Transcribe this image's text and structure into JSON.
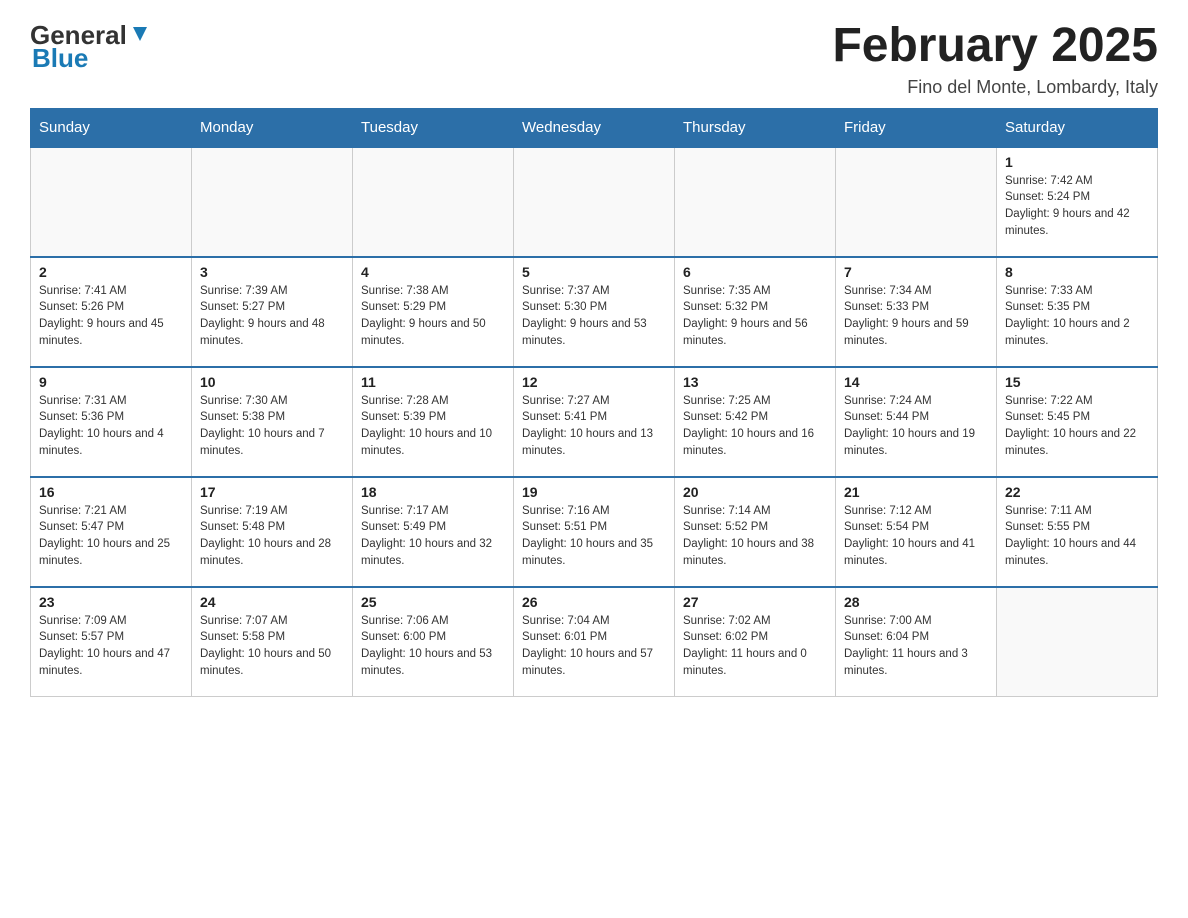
{
  "header": {
    "logo_general": "General",
    "logo_blue": "Blue",
    "month_title": "February 2025",
    "subtitle": "Fino del Monte, Lombardy, Italy"
  },
  "weekdays": [
    "Sunday",
    "Monday",
    "Tuesday",
    "Wednesday",
    "Thursday",
    "Friday",
    "Saturday"
  ],
  "weeks": [
    [
      {
        "day": "",
        "sunrise": "",
        "sunset": "",
        "daylight": ""
      },
      {
        "day": "",
        "sunrise": "",
        "sunset": "",
        "daylight": ""
      },
      {
        "day": "",
        "sunrise": "",
        "sunset": "",
        "daylight": ""
      },
      {
        "day": "",
        "sunrise": "",
        "sunset": "",
        "daylight": ""
      },
      {
        "day": "",
        "sunrise": "",
        "sunset": "",
        "daylight": ""
      },
      {
        "day": "",
        "sunrise": "",
        "sunset": "",
        "daylight": ""
      },
      {
        "day": "1",
        "sunrise": "Sunrise: 7:42 AM",
        "sunset": "Sunset: 5:24 PM",
        "daylight": "Daylight: 9 hours and 42 minutes."
      }
    ],
    [
      {
        "day": "2",
        "sunrise": "Sunrise: 7:41 AM",
        "sunset": "Sunset: 5:26 PM",
        "daylight": "Daylight: 9 hours and 45 minutes."
      },
      {
        "day": "3",
        "sunrise": "Sunrise: 7:39 AM",
        "sunset": "Sunset: 5:27 PM",
        "daylight": "Daylight: 9 hours and 48 minutes."
      },
      {
        "day": "4",
        "sunrise": "Sunrise: 7:38 AM",
        "sunset": "Sunset: 5:29 PM",
        "daylight": "Daylight: 9 hours and 50 minutes."
      },
      {
        "day": "5",
        "sunrise": "Sunrise: 7:37 AM",
        "sunset": "Sunset: 5:30 PM",
        "daylight": "Daylight: 9 hours and 53 minutes."
      },
      {
        "day": "6",
        "sunrise": "Sunrise: 7:35 AM",
        "sunset": "Sunset: 5:32 PM",
        "daylight": "Daylight: 9 hours and 56 minutes."
      },
      {
        "day": "7",
        "sunrise": "Sunrise: 7:34 AM",
        "sunset": "Sunset: 5:33 PM",
        "daylight": "Daylight: 9 hours and 59 minutes."
      },
      {
        "day": "8",
        "sunrise": "Sunrise: 7:33 AM",
        "sunset": "Sunset: 5:35 PM",
        "daylight": "Daylight: 10 hours and 2 minutes."
      }
    ],
    [
      {
        "day": "9",
        "sunrise": "Sunrise: 7:31 AM",
        "sunset": "Sunset: 5:36 PM",
        "daylight": "Daylight: 10 hours and 4 minutes."
      },
      {
        "day": "10",
        "sunrise": "Sunrise: 7:30 AM",
        "sunset": "Sunset: 5:38 PM",
        "daylight": "Daylight: 10 hours and 7 minutes."
      },
      {
        "day": "11",
        "sunrise": "Sunrise: 7:28 AM",
        "sunset": "Sunset: 5:39 PM",
        "daylight": "Daylight: 10 hours and 10 minutes."
      },
      {
        "day": "12",
        "sunrise": "Sunrise: 7:27 AM",
        "sunset": "Sunset: 5:41 PM",
        "daylight": "Daylight: 10 hours and 13 minutes."
      },
      {
        "day": "13",
        "sunrise": "Sunrise: 7:25 AM",
        "sunset": "Sunset: 5:42 PM",
        "daylight": "Daylight: 10 hours and 16 minutes."
      },
      {
        "day": "14",
        "sunrise": "Sunrise: 7:24 AM",
        "sunset": "Sunset: 5:44 PM",
        "daylight": "Daylight: 10 hours and 19 minutes."
      },
      {
        "day": "15",
        "sunrise": "Sunrise: 7:22 AM",
        "sunset": "Sunset: 5:45 PM",
        "daylight": "Daylight: 10 hours and 22 minutes."
      }
    ],
    [
      {
        "day": "16",
        "sunrise": "Sunrise: 7:21 AM",
        "sunset": "Sunset: 5:47 PM",
        "daylight": "Daylight: 10 hours and 25 minutes."
      },
      {
        "day": "17",
        "sunrise": "Sunrise: 7:19 AM",
        "sunset": "Sunset: 5:48 PM",
        "daylight": "Daylight: 10 hours and 28 minutes."
      },
      {
        "day": "18",
        "sunrise": "Sunrise: 7:17 AM",
        "sunset": "Sunset: 5:49 PM",
        "daylight": "Daylight: 10 hours and 32 minutes."
      },
      {
        "day": "19",
        "sunrise": "Sunrise: 7:16 AM",
        "sunset": "Sunset: 5:51 PM",
        "daylight": "Daylight: 10 hours and 35 minutes."
      },
      {
        "day": "20",
        "sunrise": "Sunrise: 7:14 AM",
        "sunset": "Sunset: 5:52 PM",
        "daylight": "Daylight: 10 hours and 38 minutes."
      },
      {
        "day": "21",
        "sunrise": "Sunrise: 7:12 AM",
        "sunset": "Sunset: 5:54 PM",
        "daylight": "Daylight: 10 hours and 41 minutes."
      },
      {
        "day": "22",
        "sunrise": "Sunrise: 7:11 AM",
        "sunset": "Sunset: 5:55 PM",
        "daylight": "Daylight: 10 hours and 44 minutes."
      }
    ],
    [
      {
        "day": "23",
        "sunrise": "Sunrise: 7:09 AM",
        "sunset": "Sunset: 5:57 PM",
        "daylight": "Daylight: 10 hours and 47 minutes."
      },
      {
        "day": "24",
        "sunrise": "Sunrise: 7:07 AM",
        "sunset": "Sunset: 5:58 PM",
        "daylight": "Daylight: 10 hours and 50 minutes."
      },
      {
        "day": "25",
        "sunrise": "Sunrise: 7:06 AM",
        "sunset": "Sunset: 6:00 PM",
        "daylight": "Daylight: 10 hours and 53 minutes."
      },
      {
        "day": "26",
        "sunrise": "Sunrise: 7:04 AM",
        "sunset": "Sunset: 6:01 PM",
        "daylight": "Daylight: 10 hours and 57 minutes."
      },
      {
        "day": "27",
        "sunrise": "Sunrise: 7:02 AM",
        "sunset": "Sunset: 6:02 PM",
        "daylight": "Daylight: 11 hours and 0 minutes."
      },
      {
        "day": "28",
        "sunrise": "Sunrise: 7:00 AM",
        "sunset": "Sunset: 6:04 PM",
        "daylight": "Daylight: 11 hours and 3 minutes."
      },
      {
        "day": "",
        "sunrise": "",
        "sunset": "",
        "daylight": ""
      }
    ]
  ]
}
